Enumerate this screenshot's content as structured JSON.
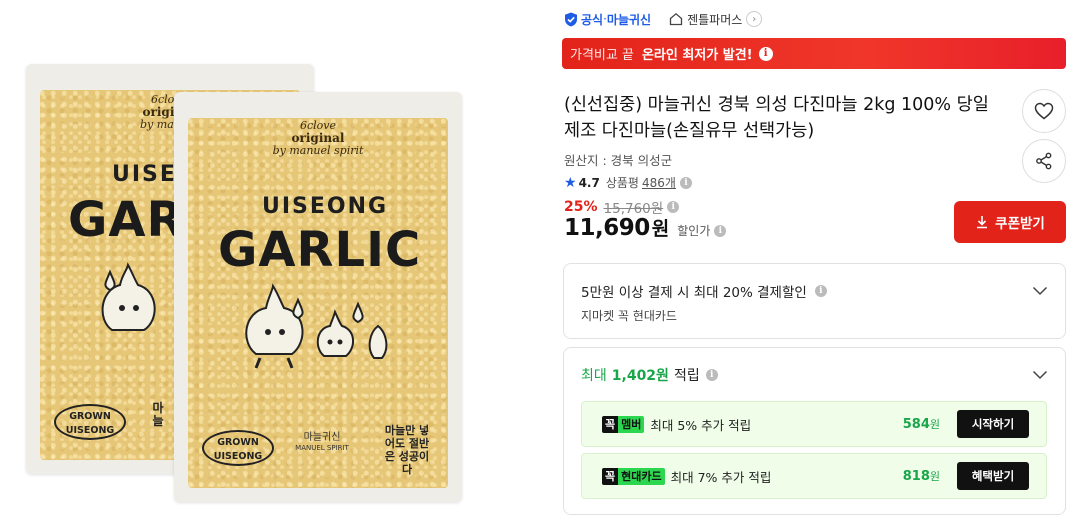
{
  "product_image": {
    "back_bag": {
      "brand_top": "6clove",
      "brand_mid": "original",
      "brand_bottom": "by manuel",
      "uiseong": "UISE",
      "garlic": "GARLIC",
      "grown": "GROWN UISEONG",
      "side_kor": "마늘"
    },
    "front_bag": {
      "brand_top": "6clove",
      "brand_mid": "original",
      "brand_bottom": "by manuel spirit",
      "uiseong": "UISEONG",
      "garlic": "GARLIC",
      "grown": "GROWN UISEONG",
      "manuel": "마늘귀신",
      "manuel_en": "MANUEL SPIRIT",
      "side_kor": "마늘만 넣어도 절반은 성공이다"
    }
  },
  "shop": {
    "official_label": "공식",
    "separator": " · ",
    "brand": "마늘귀신",
    "store_name": "젠틀파머스"
  },
  "banner": {
    "prefix": "가격비교 끝",
    "highlight": "온라인 최저가 발견!"
  },
  "product": {
    "title": "(신선집중) 마늘귀신 경북 의성 다진마늘 2kg 100% 당일제조 다진마늘(손질유무 선택가능)",
    "origin": "원산지 : 경북 의성군",
    "rating": "4.7",
    "review_label": "상품평",
    "review_count": "486개",
    "discount": "25%",
    "original_price": "15,760원",
    "sale_price": "11,690",
    "won": "원",
    "discount_label": "할인가",
    "coupon_button": "쿠폰받기"
  },
  "card_promo": {
    "main": "5만원 이상 결제 시 최대 20% 결제할인",
    "sub": "지마켓 꼭 현대카드"
  },
  "rewards": {
    "max_label": "최대",
    "points": "1,402원",
    "earn_label": "적립",
    "perks": [
      {
        "tag_k": "꼭",
        "tag": "멤버",
        "text": "최대 5% 추가 적립",
        "value": "584",
        "unit": "원",
        "button": "시작하기"
      },
      {
        "tag_k": "꼭",
        "tag": "현대카드",
        "text": "최대 7% 추가 적립",
        "value": "818",
        "unit": "원",
        "button": "혜택받기"
      }
    ]
  },
  "colors": {
    "accent_red": "#e2231a",
    "brand_blue": "#1f5ce6",
    "reward_green": "#19a64a"
  }
}
